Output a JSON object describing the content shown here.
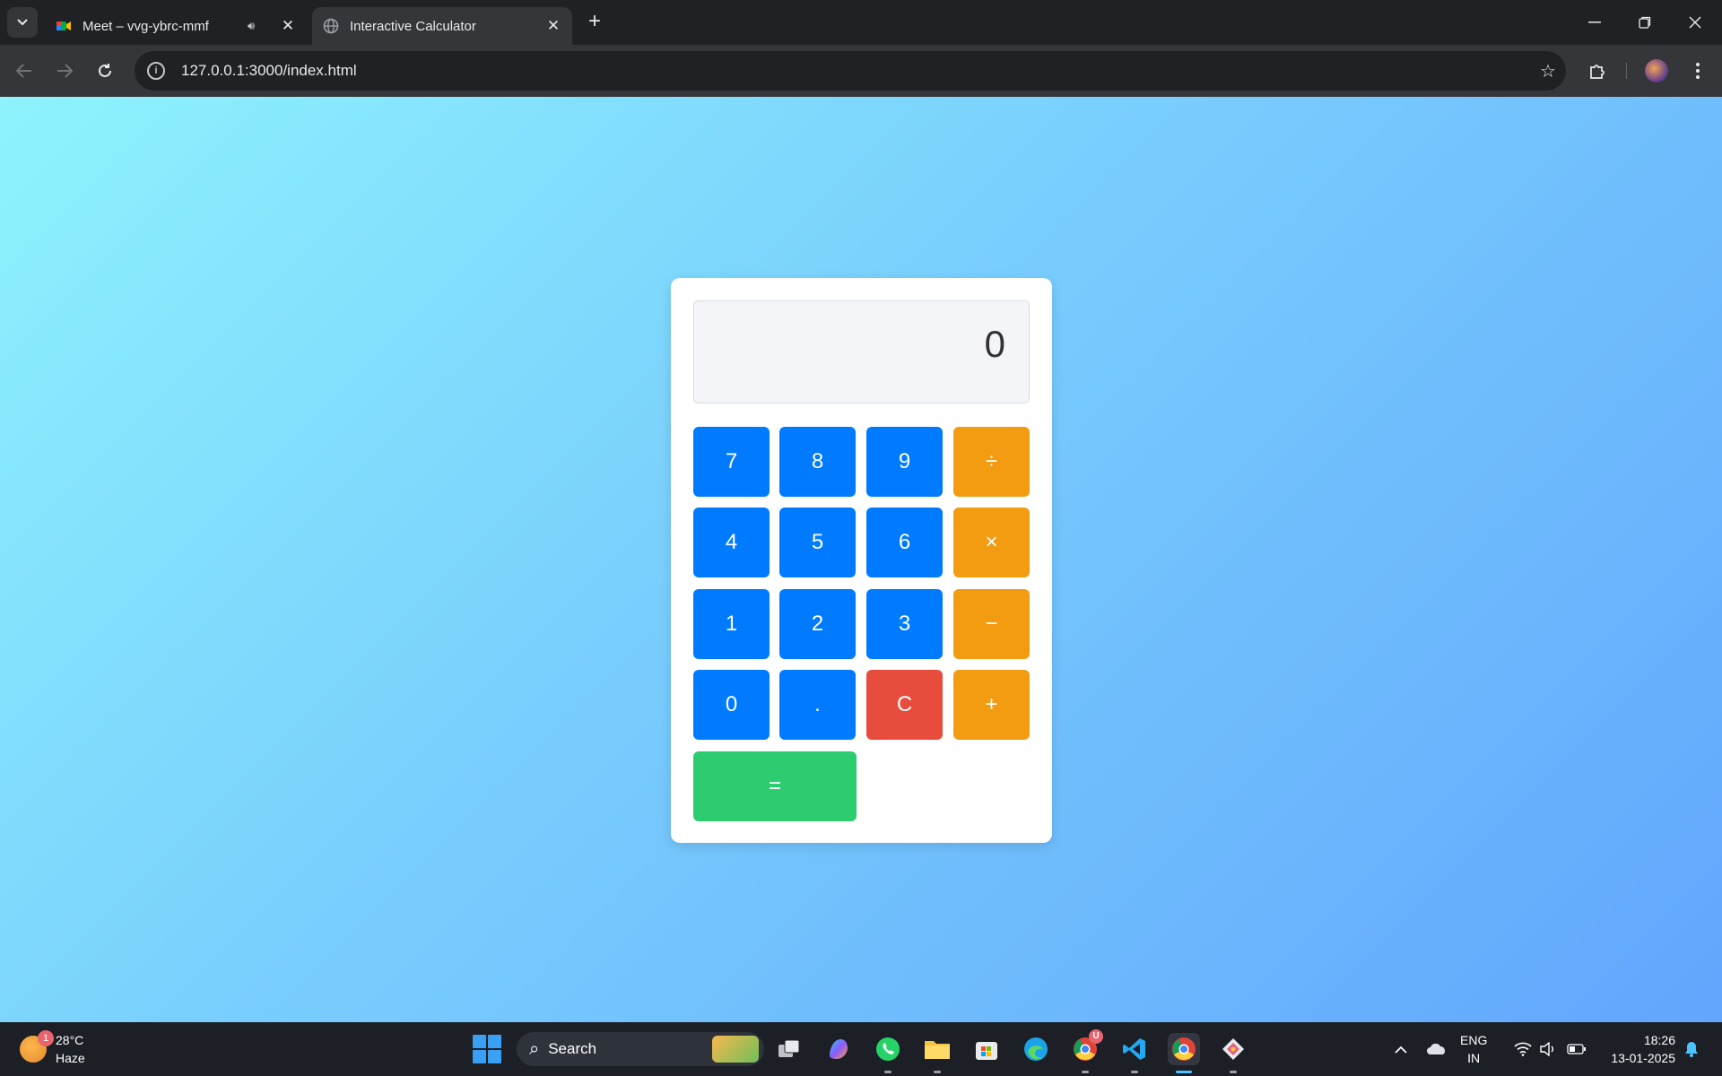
{
  "browser": {
    "tabs": [
      {
        "title": "Meet – vvg-ybrc-mmf",
        "audio": true,
        "active": false
      },
      {
        "title": "Interactive Calculator",
        "active": true
      }
    ],
    "address": "127.0.0.1:3000/index.html"
  },
  "calculator": {
    "display": "0",
    "keys": {
      "k7": "7",
      "k8": "8",
      "k9": "9",
      "div": "÷",
      "k4": "4",
      "k5": "5",
      "k6": "6",
      "mul": "×",
      "k1": "1",
      "k2": "2",
      "k3": "3",
      "sub": "−",
      "k0": "0",
      "dot": ".",
      "clear": "C",
      "add": "+",
      "equals": "="
    },
    "colors": {
      "number": "#007bff",
      "operator": "#f39c12",
      "clear": "#e74c3c",
      "equals": "#2ecc71"
    }
  },
  "taskbar": {
    "weather": {
      "temp": "28°C",
      "condition": "Haze",
      "badge": "1"
    },
    "search_placeholder": "Search",
    "chrome_badge": "U",
    "lang_line1": "ENG",
    "lang_line2": "IN",
    "time": "18:26",
    "date": "13-01-2025"
  }
}
